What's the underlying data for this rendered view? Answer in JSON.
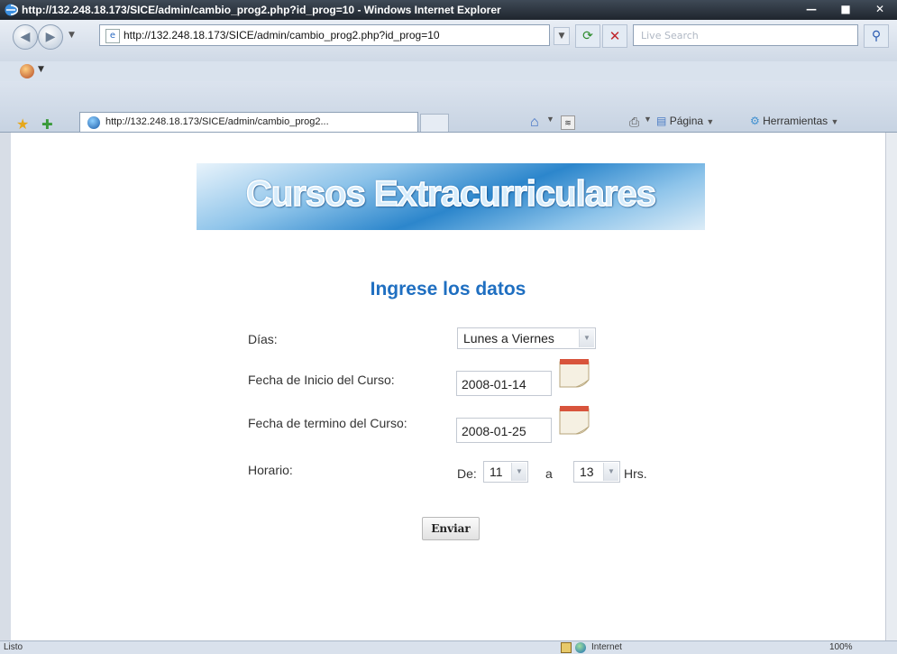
{
  "window": {
    "title": "http://132.248.18.173/SICE/admin/cambio_prog2.php?id_prog=10 - Windows Internet Explorer",
    "minimize": "—",
    "maximize": "■",
    "close": "✕"
  },
  "address_bar": {
    "url": "http://132.248.18.173/SICE/admin/cambio_prog2.php?id_prog=10",
    "search_placeholder": "Live Search"
  },
  "tab": {
    "label": "http://132.248.18.173/SICE/admin/cambio_prog2..."
  },
  "command_bar": {
    "page_label": "Página",
    "tools_label": "Herramientas"
  },
  "page": {
    "banner_title": "Cursos Extracurriculares",
    "heading": "Ingrese los datos",
    "dias_label": "Días:",
    "dias_value": "Lunes a Viernes",
    "fecha_inicio_label": "Fecha de Inicio del Curso:",
    "fecha_inicio_value": "2008-01-14",
    "fecha_termino_label": "Fecha de termino del Curso:",
    "fecha_termino_value": "2008-01-25",
    "horario_label": "Horario:",
    "de_label": "De:",
    "hora_inicio": "11",
    "a_label": "a",
    "hora_fin": "13",
    "hrs_label": "Hrs.",
    "submit_label": "Enviar"
  },
  "status_bar": {
    "status": "Listo",
    "zone": "Internet",
    "zoom": "100%"
  },
  "icons": [
    "ie-logo-icon",
    "back-icon",
    "forward-icon",
    "page-icon",
    "refresh-icon",
    "stop-icon",
    "search-icon",
    "favorites-star-icon",
    "add-favorites-icon",
    "home-icon",
    "feeds-icon",
    "print-icon",
    "page-menu-icon",
    "tools-gear-icon",
    "calendar-icon",
    "globe-icon"
  ]
}
